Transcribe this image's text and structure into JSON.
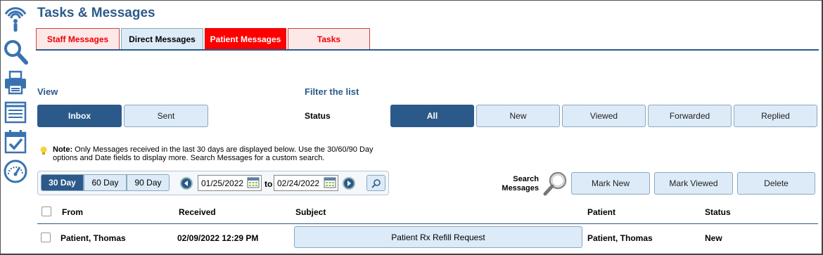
{
  "app": {
    "title": "Tasks & Messages"
  },
  "sidebar": {
    "icons": [
      "signal-icon",
      "search-icon",
      "printer-icon",
      "notes-icon",
      "calendar-check-icon",
      "dashboard-gauge-icon"
    ]
  },
  "tabs": [
    {
      "label": "Staff Messages"
    },
    {
      "label": "Direct Messages"
    },
    {
      "label": "Patient Messages",
      "active": true
    },
    {
      "label": "Tasks"
    }
  ],
  "view": {
    "heading": "View",
    "buttons": [
      {
        "label": "Inbox",
        "selected": true
      },
      {
        "label": "Sent"
      }
    ]
  },
  "filter": {
    "heading": "Filter the list",
    "status_label": "Status",
    "buttons": [
      {
        "label": "All",
        "selected": true
      },
      {
        "label": "New"
      },
      {
        "label": "Viewed"
      },
      {
        "label": "Forwarded"
      },
      {
        "label": "Replied"
      }
    ]
  },
  "note": {
    "prefix": "Note:",
    "text": "Only Messages received in the last 30 days are displayed below. Use the 30/60/90 Day options and Date fields to display more. Search Messages for a custom search."
  },
  "range": {
    "options": [
      {
        "label": "30 Day",
        "selected": true
      },
      {
        "label": "60 Day"
      },
      {
        "label": "90 Day"
      }
    ],
    "from_date": "01/25/2022",
    "to_label": "to",
    "to_date": "02/24/2022"
  },
  "search": {
    "label": "Search Messages"
  },
  "actions": {
    "mark_new": "Mark New",
    "mark_viewed": "Mark Viewed",
    "delete": "Delete"
  },
  "table": {
    "columns": {
      "from": "From",
      "received": "Received",
      "subject": "Subject",
      "patient": "Patient",
      "status": "Status"
    },
    "rows": [
      {
        "from": "Patient, Thomas",
        "received": "02/09/2022 12:29 PM",
        "subject": "Patient Rx Refill Request",
        "patient": "Patient, Thomas",
        "status": "New"
      }
    ]
  },
  "colors": {
    "accent": "#2b5a8a",
    "active_tab": "#ff0000",
    "button_bg": "#dcebf7"
  }
}
